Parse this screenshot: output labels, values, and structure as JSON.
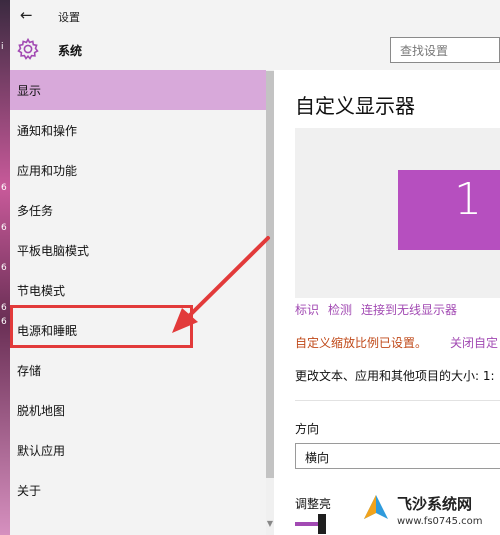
{
  "titlebar": {
    "back_icon": "back-arrow-icon",
    "title": "设置"
  },
  "header": {
    "section_icon": "gear-icon",
    "section_title": "系统",
    "search_placeholder": "查找设置"
  },
  "desktop": {
    "edge_glyphs": [
      "i",
      "6",
      "6",
      "6",
      "6",
      "6"
    ]
  },
  "sidebar": {
    "items": [
      {
        "label": "显示",
        "selected": true
      },
      {
        "label": "通知和操作"
      },
      {
        "label": "应用和功能"
      },
      {
        "label": "多任务"
      },
      {
        "label": "平板电脑模式"
      },
      {
        "label": "节电模式"
      },
      {
        "label": "电源和睡眠",
        "highlighted": true
      },
      {
        "label": "存储"
      },
      {
        "label": "脱机地图"
      },
      {
        "label": "默认应用"
      },
      {
        "label": "关于"
      }
    ]
  },
  "content": {
    "title": "自定义显示器",
    "monitor_number": "1",
    "links": [
      "标识",
      "检测",
      "连接到无线显示器"
    ],
    "notice": "自定义缩放比例已设置。",
    "notice_link": "关闭自定",
    "size_label": "更改文本、应用和其他项目的大小: 1:",
    "orientation_label": "方向",
    "orientation_value": "横向",
    "brightness_label": "调整亮"
  },
  "watermark": {
    "name": "飞沙系统网",
    "url": "www.fs0745.com"
  },
  "colors": {
    "accent": "#a24ab3",
    "selected_bg": "#d8a9da",
    "monitor": "#b64fbf",
    "annotation": "#e23a3a",
    "notice": "#c04a1a"
  }
}
